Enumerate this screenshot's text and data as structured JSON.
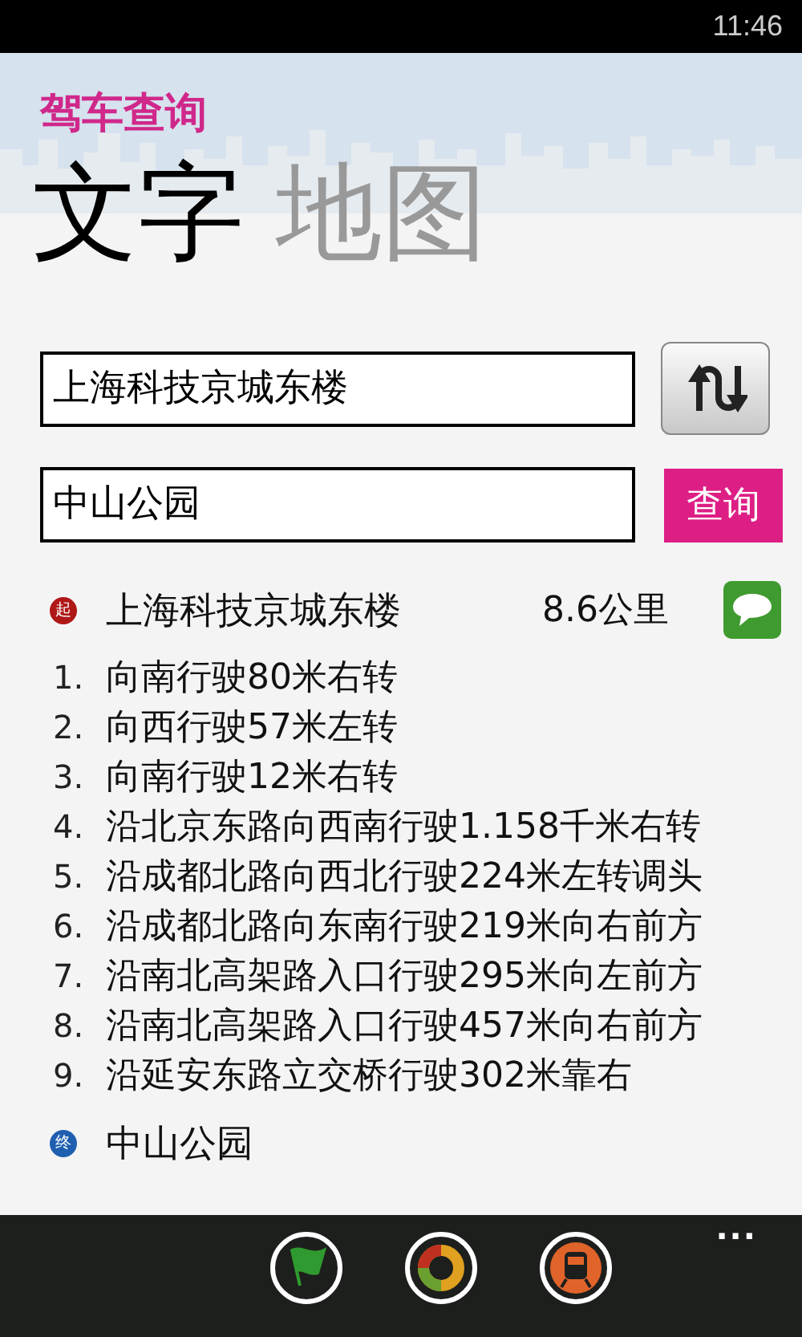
{
  "status_bar": {
    "time": "11:46"
  },
  "app_title": "驾车查询",
  "tabs": [
    {
      "label": "文字",
      "selected": true
    },
    {
      "label": "地图",
      "selected": false
    }
  ],
  "from_field": {
    "value": "上海科技京城东楼"
  },
  "to_field": {
    "value": "中山公园"
  },
  "query_button": "查询",
  "start": {
    "badge": "起",
    "name": "上海科技京城东楼",
    "distance": "8.6公里"
  },
  "steps": [
    {
      "number": "1.",
      "text": "向南行驶80米右转"
    },
    {
      "number": "2.",
      "text": "向西行驶57米左转"
    },
    {
      "number": "3.",
      "text": "向南行驶12米右转"
    },
    {
      "number": "4.",
      "text": "沿北京东路向西南行驶1.158千米右转"
    },
    {
      "number": "5.",
      "text": "沿成都北路向西北行驶224米左转调头"
    },
    {
      "number": "6.",
      "text": "沿成都北路向东南行驶219米向右前方"
    },
    {
      "number": "7.",
      "text": "沿南北高架路入口行驶295米向左前方"
    },
    {
      "number": "8.",
      "text": "沿南北高架路入口行驶457米向右前方"
    },
    {
      "number": "9.",
      "text": "沿延安东路立交桥行驶302米靠右"
    }
  ],
  "end": {
    "badge": "终",
    "name": "中山公园"
  },
  "app_bar": {
    "buttons": [
      {
        "kind": "flag"
      },
      {
        "kind": "ring"
      },
      {
        "kind": "train"
      }
    ],
    "more": "..."
  }
}
